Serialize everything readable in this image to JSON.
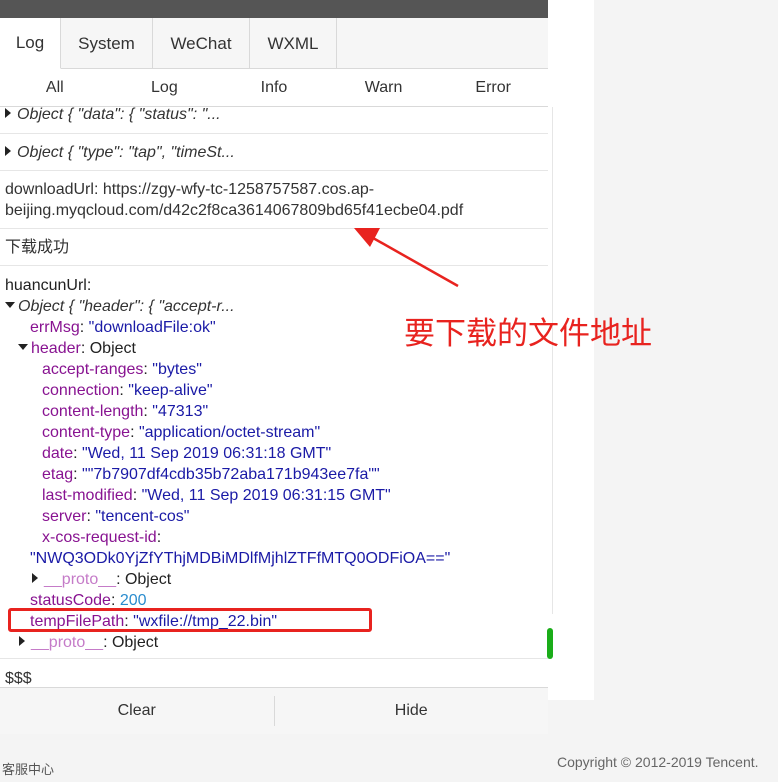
{
  "tabs": [
    {
      "label": "Log",
      "active": true
    },
    {
      "label": "System",
      "active": false
    },
    {
      "label": "WeChat",
      "active": false
    },
    {
      "label": "WXML",
      "active": false
    }
  ],
  "filters": [
    "All",
    "Log",
    "Info",
    "Warn",
    "Error"
  ],
  "entries": {
    "obj_data": "Object { \"data\": { \"status\": \"...",
    "obj_type": "Object { \"type\": \"tap\", \"timeSt...",
    "download_line1": "downloadUrl: https://zgy-wfy-tc-1258757587.cos.ap-",
    "download_line2": "beijing.myqcloud.com/d42c2f8ca3614067809bd65f41ecbe04.pdf",
    "success": "下载成功",
    "huancun_label": "huancunUrl:",
    "obj_header": "Object { \"header\": { \"accept-r...",
    "errMsg_key": "errMsg",
    "errMsg_val": "\"downloadFile:ok\"",
    "header_key": "header",
    "header_val": "Object",
    "accept_ranges_key": "accept-ranges",
    "accept_ranges_val": "\"bytes\"",
    "connection_key": "connection",
    "connection_val": "\"keep-alive\"",
    "content_length_key": "content-length",
    "content_length_val": "\"47313\"",
    "content_type_key": "content-type",
    "content_type_val": "\"application/octet-stream\"",
    "date_key": "date",
    "date_val": "\"Wed, 11 Sep 2019 06:31:18 GMT\"",
    "etag_key": "etag",
    "etag_val": "\"\"7b7907df4cdb35b72aba171b943ee7fa\"\"",
    "last_modified_key": "last-modified",
    "last_modified_val": "\"Wed, 11 Sep 2019 06:31:15 GMT\"",
    "server_key": "server",
    "server_val": "\"tencent-cos\"",
    "x_cos_key": "x-cos-request-id",
    "x_cos_val": "\"NWQ3ODk0YjZfYThjMDBiMDlfMjhlZTFfMTQ0ODFiOA==\"",
    "proto_inner_key": "__proto__",
    "proto_inner_val": "Object",
    "status_code_key": "statusCode",
    "status_code_val": "200",
    "temp_file_key": "tempFilePath",
    "temp_file_val": "\"wxfile://tmp_22.bin\"",
    "proto_outer_key": "__proto__",
    "proto_outer_val": "Object",
    "dollars": "$$$"
  },
  "bottom_buttons": {
    "clear": "Clear",
    "hide": "Hide"
  },
  "annotation_label": "要下载的文件地址",
  "footer": {
    "left": "客服中心",
    "right": "Copyright © 2012-2019 Tencent."
  },
  "colors": {
    "annotation": "#e8231f",
    "active_indicator": "#1aad19",
    "key": "#881391",
    "string": "#1a1aa6"
  }
}
